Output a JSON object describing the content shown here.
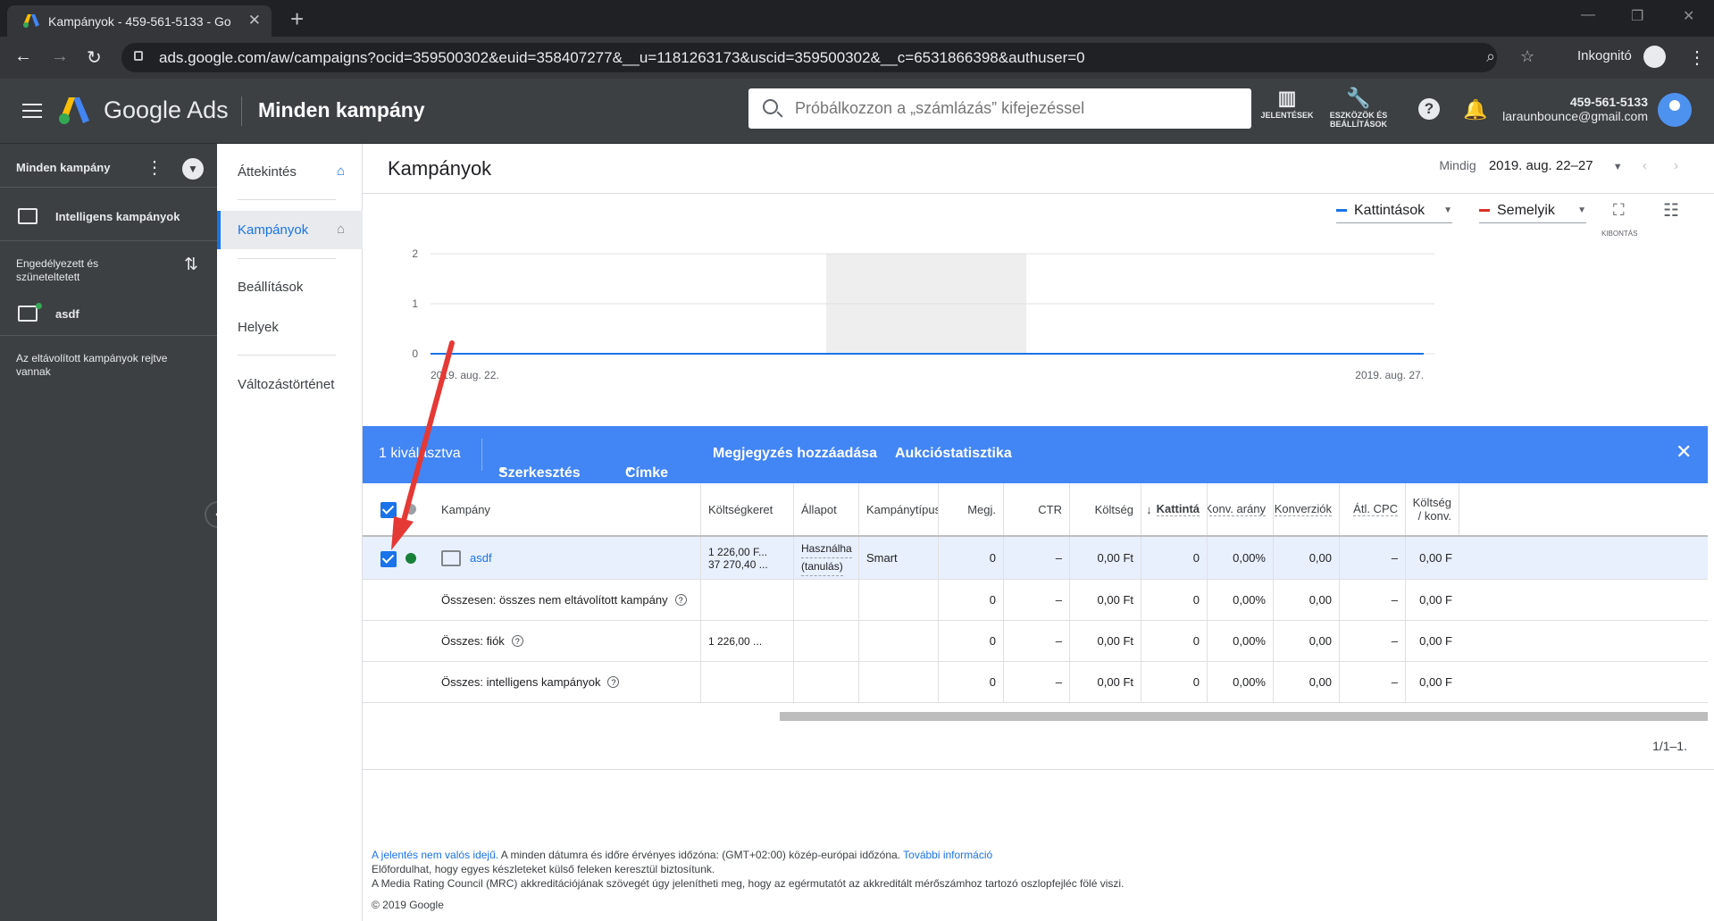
{
  "browser": {
    "tab_title": "Kampányok - 459-561-5133 - Go",
    "url": "ads.google.com/aw/campaigns?ocid=359500302&euid=358407277&__u=1181263173&uscid=359500302&__c=6531866398&authuser=0",
    "incognito_label": "Inkognitó"
  },
  "header": {
    "brand": "Google Ads",
    "page_title": "Minden kampány",
    "search_placeholder": "Próbálkozzon a „számlázás” kifejezéssel",
    "tools": [
      {
        "label": "JELENTÉSEK",
        "icon": "reports-icon"
      },
      {
        "label": "ESZKÖZÖK ÉS BEÁLLÍTÁSOK",
        "icon": "wrench-icon"
      }
    ],
    "account_id": "459-561-5133",
    "account_email": "laraunbounce@gmail.com"
  },
  "left_nav": {
    "all_campaigns": "Minden kampány",
    "smart_campaigns": "Intelligens kampányok",
    "filter_label": "Engedélyezett és szüneteltetett",
    "campaign": "asdf",
    "removed_note": "Az eltávolított kampányok rejtve vannak"
  },
  "sub_nav": {
    "items": [
      "Áttekintés",
      "Kampányok",
      "Beállítások",
      "Helyek",
      "Változástörténet"
    ]
  },
  "main": {
    "title": "Kampányok",
    "date_label": "Mindig",
    "date_range": "2019. aug. 22–27",
    "metric1": "Kattintások",
    "metric2": "Semelyik",
    "expand_label": "KIBONTÁS",
    "colors": {
      "metric1": "#1a73e8",
      "metric2": "#d93025",
      "accent": "#4285f4"
    }
  },
  "chart_data": {
    "type": "line",
    "x": [
      "2019. aug. 22.",
      "2019. aug. 27."
    ],
    "series": [
      {
        "name": "Kattintások",
        "values": [
          0,
          0
        ]
      }
    ],
    "yticks": [
      "2",
      "1",
      "0"
    ],
    "ylim": [
      0,
      2
    ]
  },
  "action_bar": {
    "selected": "1 kiválasztva",
    "edit": "Szerkesztés",
    "label": "Címke",
    "add_note": "Megjegyzés hozzáadása",
    "auction": "Aukcióstatisztika"
  },
  "table": {
    "headers": [
      "Kampány",
      "Költségkeret",
      "Állapot",
      "Kampánytípus",
      "Megj.",
      "CTR",
      "Költség",
      "Kattintá",
      "Konv. arány",
      "Konverziók",
      "Átl. CPC",
      "Költség / konv."
    ],
    "row": {
      "name": "asdf",
      "budget1": "1 226,00 F...",
      "budget2": "37 270,40 ...",
      "status1": "Használható",
      "status2": "(tanulás)",
      "type": "Smart",
      "impr": "0",
      "ctr": "–",
      "cost": "0,00 Ft",
      "clicks": "0",
      "conv_rate": "0,00%",
      "conv": "0,00",
      "cpc": "–",
      "cost_conv": "0,00 F"
    },
    "totals": [
      {
        "label": "Összesen: összes nem eltávolított kampány",
        "budget": "",
        "impr": "0",
        "ctr": "–",
        "cost": "0,00 Ft",
        "clicks": "0",
        "conv_rate": "0,00%",
        "conv": "0,00",
        "cpc": "–",
        "cost_conv": "0,00 F"
      },
      {
        "label": "Összes: fiók",
        "budget": "1 226,00 ...",
        "impr": "0",
        "ctr": "–",
        "cost": "0,00 Ft",
        "clicks": "0",
        "conv_rate": "0,00%",
        "conv": "0,00",
        "cpc": "–",
        "cost_conv": "0,00 F"
      },
      {
        "label": "Összes: intelligens kampányok",
        "budget": "",
        "impr": "0",
        "ctr": "–",
        "cost": "0,00 Ft",
        "clicks": "0",
        "conv_rate": "0,00%",
        "conv": "0,00",
        "cpc": "–",
        "cost_conv": "0,00 F"
      }
    ],
    "pager": "1/1–1."
  },
  "footer": {
    "link1": "A jelentés nem valós idejű.",
    "text1": " A minden dátumra és időre érvényes időzóna: (GMT+02:00) közép-európai időzóna. ",
    "link2": "További információ",
    "text2": "Előfordulhat, hogy egyes készleteket külső feleken keresztül biztosítunk.",
    "text3": "A Media Rating Council (MRC) akkreditációjának szövegét úgy jelenítheti meg, hogy az egérmutatót az akkreditált mérőszámhoz tartozó oszlopfejléc fölé viszi.",
    "copyright": "© 2019 Google"
  }
}
